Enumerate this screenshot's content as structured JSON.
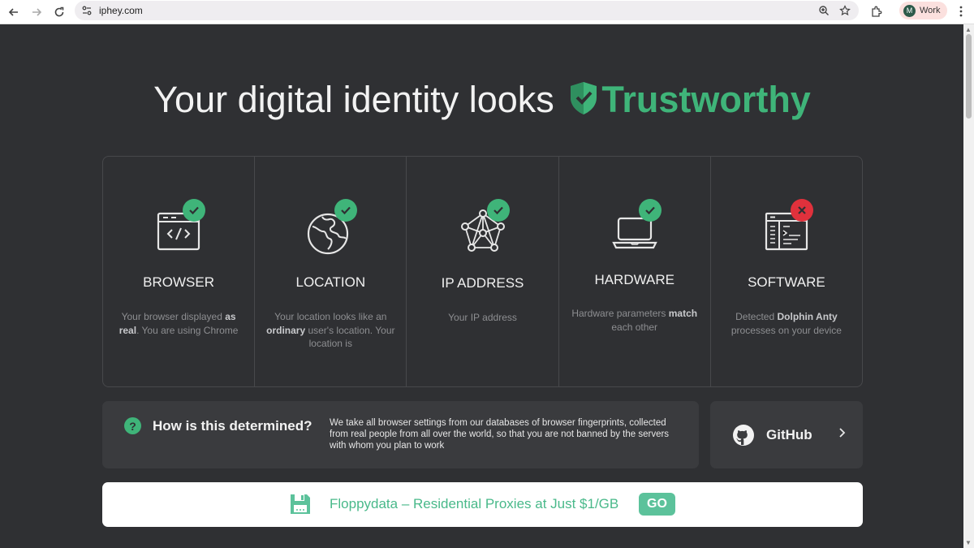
{
  "browser": {
    "url": "iphey.com",
    "profile_initial": "M",
    "profile_name": "Work"
  },
  "headline": {
    "prefix": "Your digital identity looks",
    "status": "Trustworthy",
    "status_color": "#3fb479"
  },
  "cards": [
    {
      "title": "BROWSER",
      "status": "ok",
      "icon": "browser-code-icon",
      "desc_parts": [
        "Your browser displayed ",
        "as real",
        ". You are using Chrome"
      ]
    },
    {
      "title": "LOCATION",
      "status": "ok",
      "icon": "globe-icon",
      "desc_parts": [
        "Your location looks like an ",
        "ordinary",
        " user's location. Your location is"
      ]
    },
    {
      "title": "IP ADDRESS",
      "status": "ok",
      "icon": "network-nodes-icon",
      "desc_parts": [
        "Your IP address",
        "",
        ""
      ]
    },
    {
      "title": "HARDWARE",
      "status": "ok",
      "icon": "laptop-icon",
      "desc_parts": [
        "Hardware parameters ",
        "match",
        " each other"
      ]
    },
    {
      "title": "SOFTWARE",
      "status": "fail",
      "icon": "software-window-icon",
      "desc_parts": [
        "Detected ",
        "Dolphin Anty",
        " processes on your device"
      ]
    }
  ],
  "how": {
    "title": "How is this determined?",
    "text": "We take all browser settings from our databases of browser fingerprints, collected from real people from all over the world, so that you are not banned by the servers with whom you plan to work"
  },
  "github": {
    "label": "GitHub"
  },
  "promo": {
    "text": "Floppydata – Residential Proxies at Just $1/GB",
    "button": "GO"
  },
  "colors": {
    "ok": "#3fb479",
    "fail": "#e0313c",
    "background": "#2f3033"
  }
}
